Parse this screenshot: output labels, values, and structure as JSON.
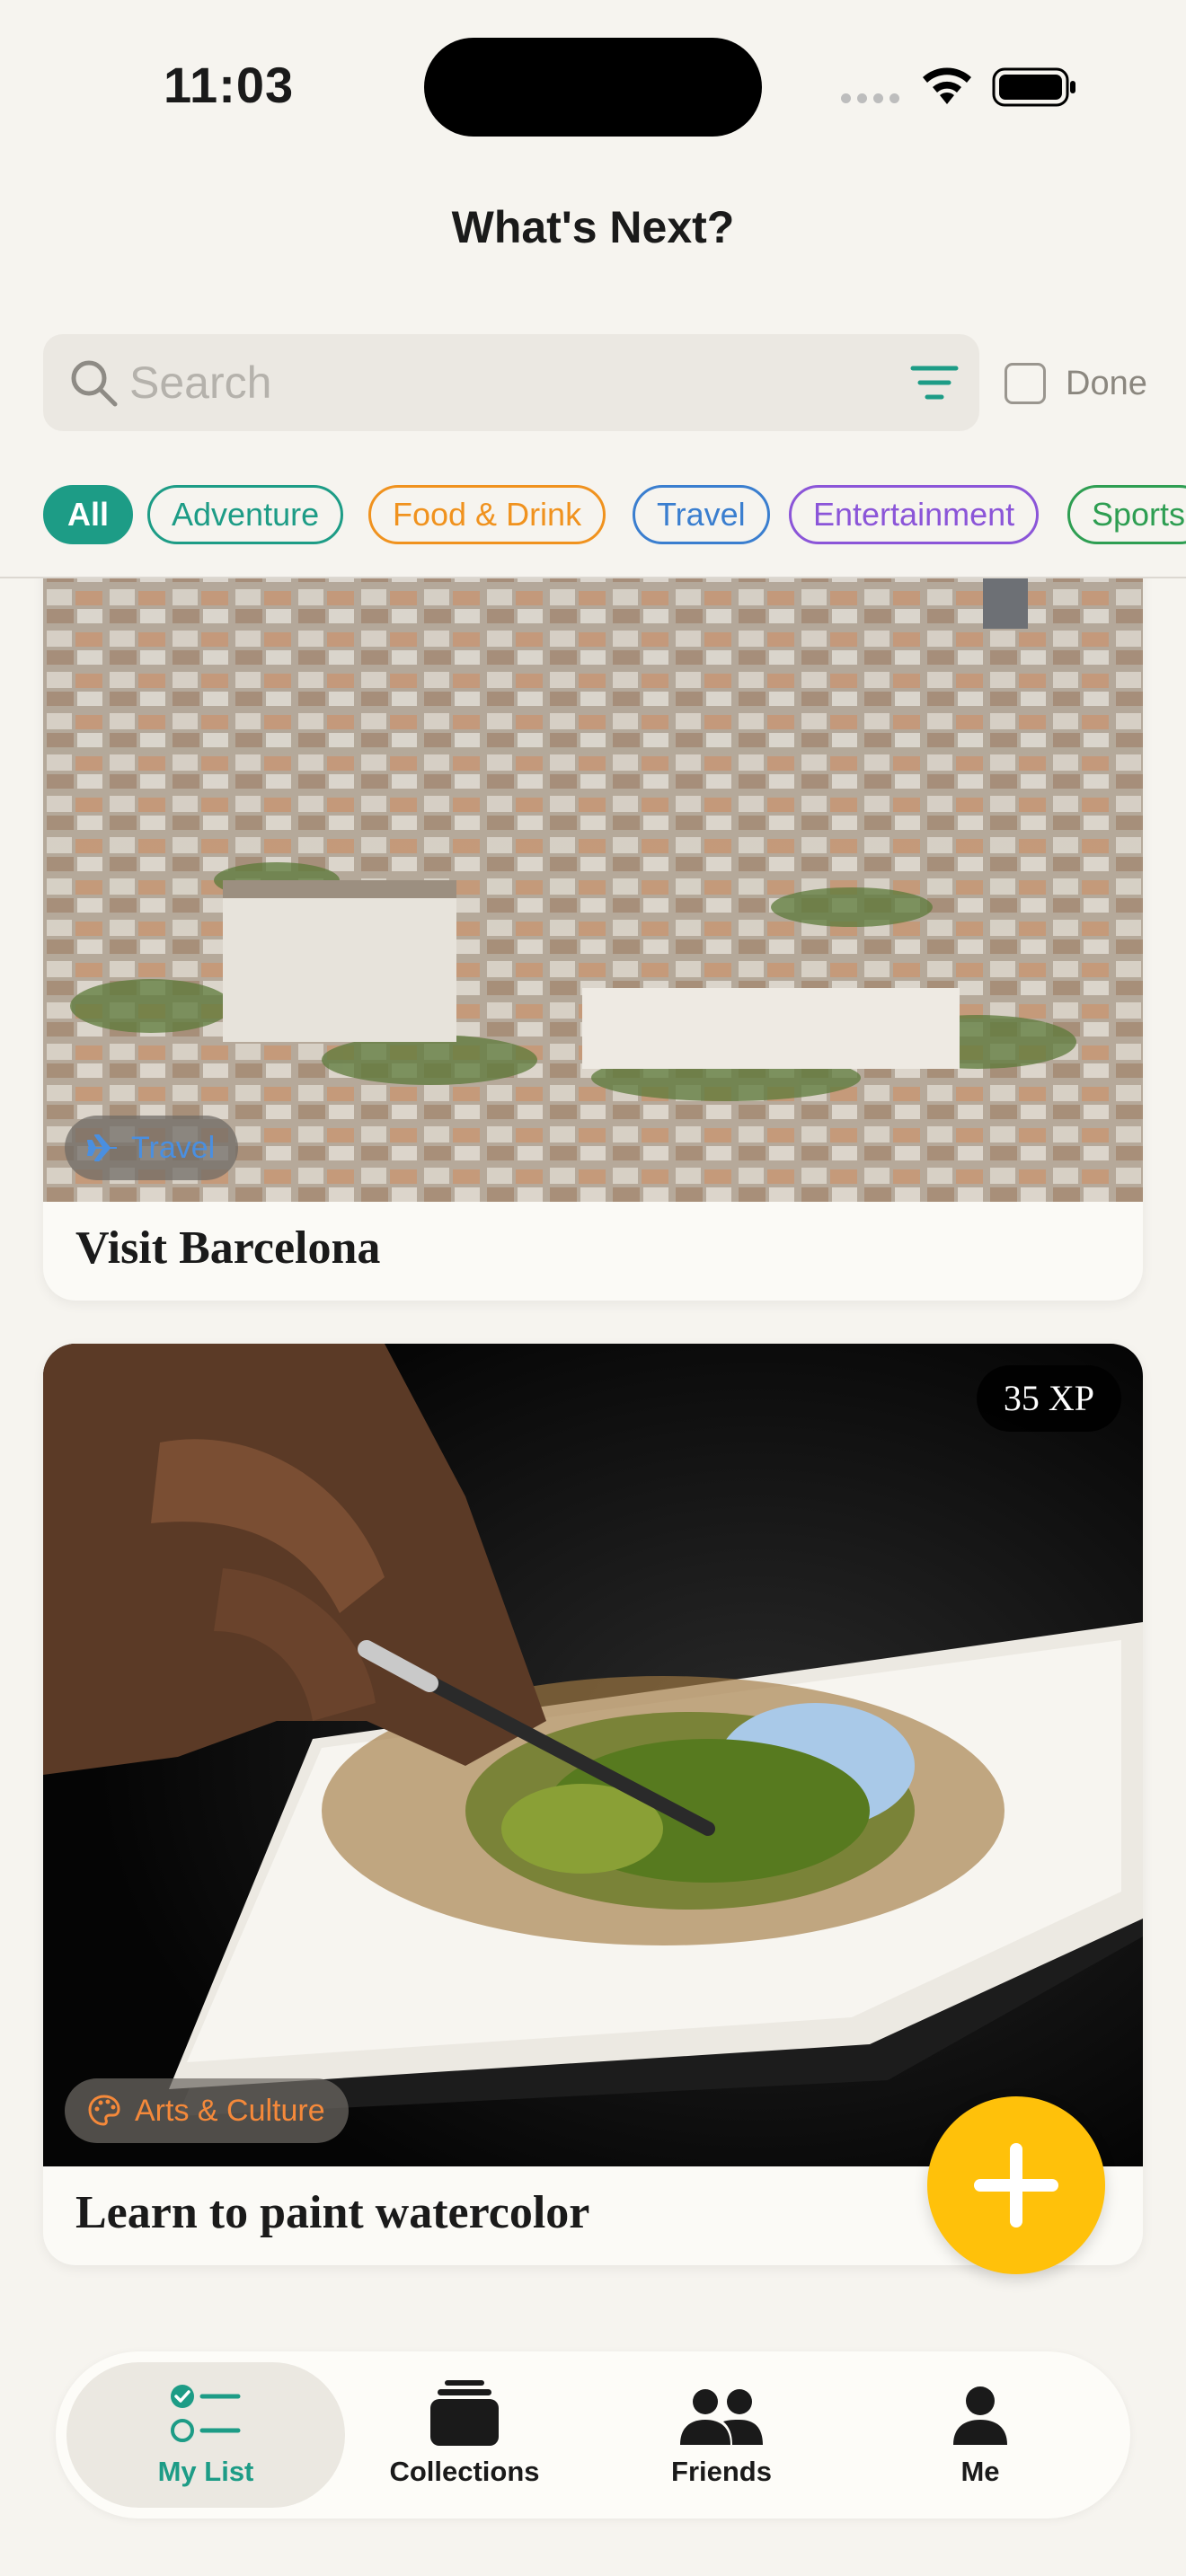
{
  "status_bar": {
    "time": "11:03"
  },
  "header": {
    "title": "What's Next?"
  },
  "search": {
    "placeholder": "Search",
    "done_label": "Done"
  },
  "categories": [
    {
      "label": "All",
      "color": "#1d9c86",
      "selected": true
    },
    {
      "label": "Adventure",
      "color": "#1d9c86"
    },
    {
      "label": "Food & Drink",
      "color": "#f0921e"
    },
    {
      "label": "Travel",
      "color": "#3a7ecf"
    },
    {
      "label": "Entertainment",
      "color": "#8b55d8"
    },
    {
      "label": "Sports",
      "color": "#2e9e52"
    }
  ],
  "cards": [
    {
      "title": "Visit Barcelona",
      "category": "Travel",
      "category_color": "#4a8fe0",
      "category_icon": "airplane-icon"
    },
    {
      "title": "Learn to paint watercolor",
      "category": "Arts & Culture",
      "category_color": "#f5893a",
      "category_icon": "palette-icon",
      "xp": "35 XP"
    }
  ],
  "fab": {
    "icon": "plus-icon",
    "color": "#ffc10a"
  },
  "tabbar": {
    "items": [
      {
        "label": "My List",
        "icon": "checklist-icon",
        "active": true
      },
      {
        "label": "Collections",
        "icon": "collections-icon"
      },
      {
        "label": "Friends",
        "icon": "friends-icon"
      },
      {
        "label": "Me",
        "icon": "person-icon"
      }
    ]
  },
  "colors": {
    "accent": "#1d9c86",
    "background": "#f6f4ef"
  }
}
